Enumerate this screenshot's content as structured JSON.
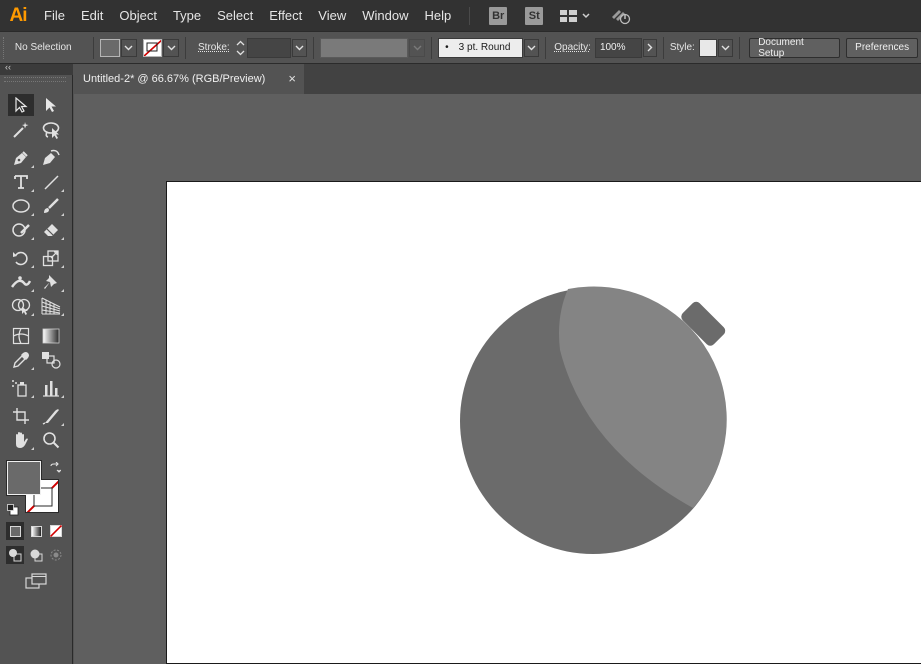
{
  "app": {
    "logo": "Ai",
    "menu": [
      "File",
      "Edit",
      "Object",
      "Type",
      "Select",
      "Effect",
      "View",
      "Window",
      "Help"
    ],
    "bridge_label": "Br",
    "stock_label": "St",
    "workspace_icon": "workspace-grid-icon",
    "gpu_icon": "gpu-performance-icon"
  },
  "control_bar": {
    "selection_status": "No Selection",
    "fill_color": "#6a6a6a",
    "stroke_label": "Stroke:",
    "brush_label": "3 pt. Round",
    "opacity_label": "Opacity:",
    "opacity_value": "100%",
    "style_label": "Style:",
    "document_setup": "Document Setup",
    "preferences": "Preferences"
  },
  "document": {
    "tab_title": "Untitled-2* @ 66.67% (RGB/Preview)",
    "close_glyph": "×"
  },
  "tools_panel": {
    "collapse_glyph": "‹‹",
    "fill_color": "#6a6a6a",
    "stroke_color": "none"
  },
  "artwork": {
    "ornament_dark": "#6b6b6b",
    "ornament_light": "#848484",
    "cap_color": "#6b6b6b"
  }
}
